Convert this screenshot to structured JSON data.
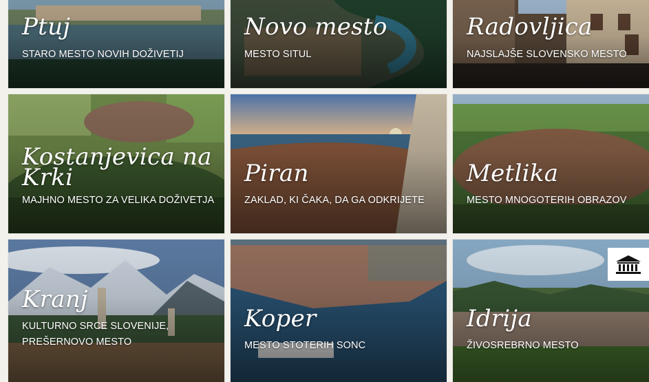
{
  "tiles": [
    {
      "name": "Ptuj",
      "subtitle": "STARO MESTO NOVIH DOŽIVETIJ"
    },
    {
      "name": "Novo mesto",
      "subtitle": "MESTO SITUL"
    },
    {
      "name": "Radovljica",
      "subtitle": "NAJSLAJŠE SLOVENSKO MESTO"
    },
    {
      "name": "Kostanjevica na Krki",
      "subtitle": "MAJHNO MESTO ZA VELIKA DOŽIVETJA"
    },
    {
      "name": "Piran",
      "subtitle": "ZAKLAD, KI ČAKA, DA GA ODKRIJETE"
    },
    {
      "name": "Metlika",
      "subtitle": "MESTO MNOGOTERIH OBRAZOV"
    },
    {
      "name": "Kranj",
      "subtitle": "KULTURNO SRCE SLOVENIJE, PREŠERNOVO MESTO"
    },
    {
      "name": "Koper",
      "subtitle": "MESTO STOTERIH SONC"
    },
    {
      "name": "Idrija",
      "subtitle": "ŽIVOSREBRNO MESTO"
    }
  ],
  "badges": {
    "idrija": "unesco-logo"
  }
}
